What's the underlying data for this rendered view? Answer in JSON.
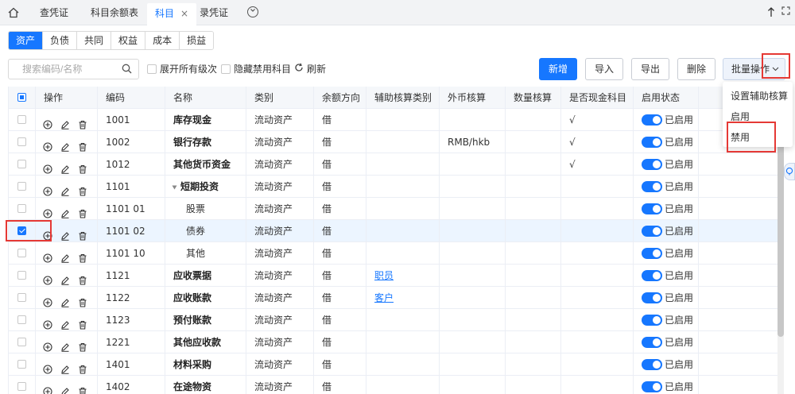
{
  "top_tabs": [
    {
      "label": "查凭证"
    },
    {
      "label": "科目余额表"
    },
    {
      "label": "科目"
    },
    {
      "label": "录凭证"
    }
  ],
  "tab_close": "×",
  "category_tabs": [
    "资产",
    "负债",
    "共同",
    "权益",
    "成本",
    "损益"
  ],
  "search": {
    "placeholder": "搜索编码/名称"
  },
  "options": {
    "expand_all": "展开所有级次",
    "hide_disabled": "隐藏禁用科目",
    "refresh": "刷新"
  },
  "buttons": {
    "add": "新增",
    "import": "导入",
    "export": "导出",
    "delete": "删除",
    "batch": "批量操作"
  },
  "batch_menu": [
    "设置辅助核算",
    "启用",
    "禁用"
  ],
  "columns": [
    "操作",
    "编码",
    "名称",
    "类别",
    "余额方向",
    "辅助核算类别",
    "外币核算",
    "数量核算",
    "是否现金科目",
    "启用状态"
  ],
  "rows": [
    {
      "code": "1001",
      "name": "库存现金",
      "category": "流动资产",
      "direction": "借",
      "aux": "",
      "fx": "",
      "qty": "",
      "cash": "√",
      "status": "已启用",
      "bold": true,
      "checked": false
    },
    {
      "code": "1002",
      "name": "银行存款",
      "category": "流动资产",
      "direction": "借",
      "aux": "",
      "fx": "RMB/hkb",
      "qty": "",
      "cash": "√",
      "status": "已启用",
      "bold": true,
      "checked": false
    },
    {
      "code": "1012",
      "name": "其他货币资金",
      "category": "流动资产",
      "direction": "借",
      "aux": "",
      "fx": "",
      "qty": "",
      "cash": "√",
      "status": "已启用",
      "bold": true,
      "checked": false
    },
    {
      "code": "1101",
      "name": "短期投资",
      "category": "流动资产",
      "direction": "借",
      "aux": "",
      "fx": "",
      "qty": "",
      "cash": "",
      "status": "已启用",
      "bold": true,
      "checked": false,
      "expanded": true
    },
    {
      "code": "1101 01",
      "name": "股票",
      "category": "流动资产",
      "direction": "借",
      "aux": "",
      "fx": "",
      "qty": "",
      "cash": "",
      "status": "已启用",
      "bold": false,
      "checked": false,
      "child": true
    },
    {
      "code": "1101 02",
      "name": "债券",
      "category": "流动资产",
      "direction": "借",
      "aux": "",
      "fx": "",
      "qty": "",
      "cash": "",
      "status": "已启用",
      "bold": false,
      "checked": true,
      "child": true
    },
    {
      "code": "1101 10",
      "name": "其他",
      "category": "流动资产",
      "direction": "借",
      "aux": "",
      "fx": "",
      "qty": "",
      "cash": "",
      "status": "已启用",
      "bold": false,
      "checked": false,
      "child": true
    },
    {
      "code": "1121",
      "name": "应收票据",
      "category": "流动资产",
      "direction": "借",
      "aux": "职员",
      "fx": "",
      "qty": "",
      "cash": "",
      "status": "已启用",
      "bold": true,
      "checked": false
    },
    {
      "code": "1122",
      "name": "应收账款",
      "category": "流动资产",
      "direction": "借",
      "aux": "客户",
      "fx": "",
      "qty": "",
      "cash": "",
      "status": "已启用",
      "bold": true,
      "checked": false
    },
    {
      "code": "1123",
      "name": "预付账款",
      "category": "流动资产",
      "direction": "借",
      "aux": "",
      "fx": "",
      "qty": "",
      "cash": "",
      "status": "已启用",
      "bold": true,
      "checked": false
    },
    {
      "code": "1221",
      "name": "其他应收款",
      "category": "流动资产",
      "direction": "借",
      "aux": "",
      "fx": "",
      "qty": "",
      "cash": "",
      "status": "已启用",
      "bold": true,
      "checked": false
    },
    {
      "code": "1401",
      "name": "材料采购",
      "category": "流动资产",
      "direction": "借",
      "aux": "",
      "fx": "",
      "qty": "",
      "cash": "",
      "status": "已启用",
      "bold": true,
      "checked": false
    },
    {
      "code": "1402",
      "name": "在途物资",
      "category": "流动资产",
      "direction": "借",
      "aux": "",
      "fx": "",
      "qty": "",
      "cash": "",
      "status": "已启用",
      "bold": true,
      "checked": false
    }
  ],
  "colors": {
    "accent": "#1677ff",
    "highlight_box": "#e53935"
  }
}
